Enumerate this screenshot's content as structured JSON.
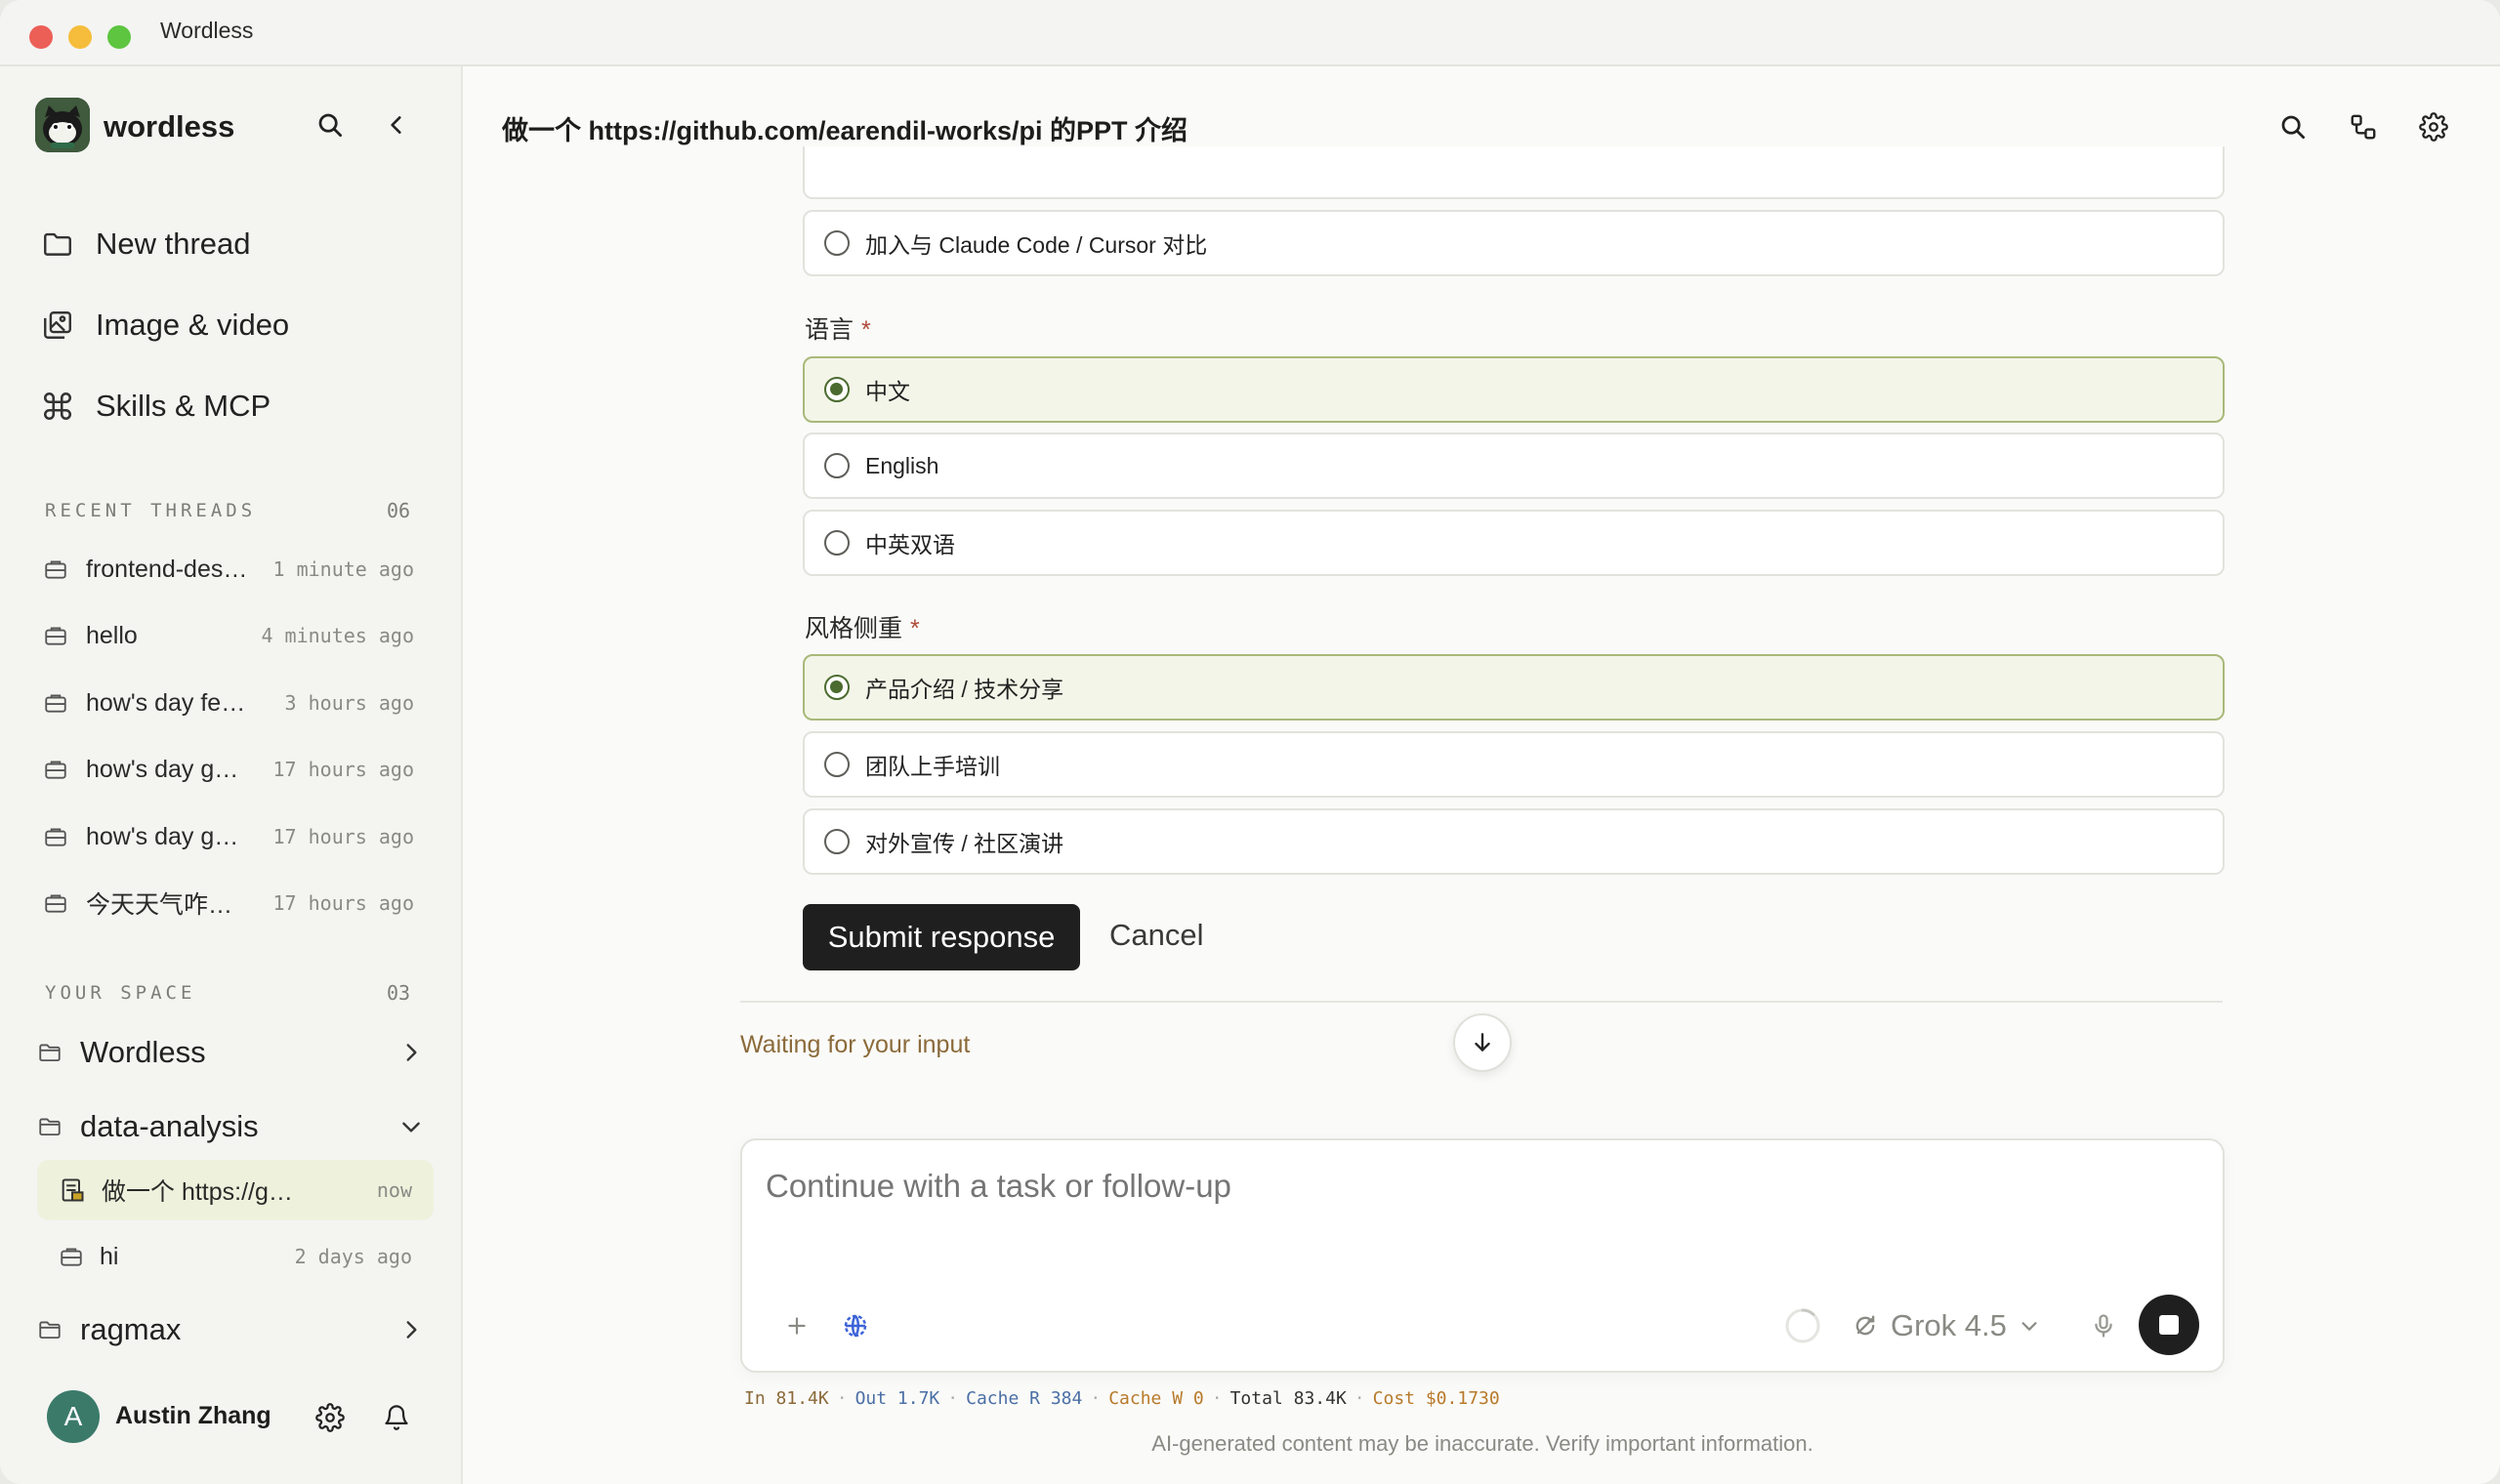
{
  "window": {
    "title": "Wordless"
  },
  "colors": {
    "accent": "#4b6b2f",
    "selected_bg": "#f3f5e8",
    "submit_bg": "#1f1f1f",
    "avatar_bg": "#3b7a69"
  },
  "sidebar": {
    "brand": "wordless",
    "nav": [
      {
        "label": "New thread",
        "icon": "folder-icon"
      },
      {
        "label": "Image & video",
        "icon": "image-gallery-icon"
      },
      {
        "label": "Skills & MCP",
        "icon": "command-icon"
      }
    ],
    "recent": {
      "label": "RECENT THREADS",
      "count": "06",
      "items": [
        {
          "title": "frontend-design",
          "time": "1 minute ago"
        },
        {
          "title": "hello",
          "time": "4 minutes ago"
        },
        {
          "title": "how's day feeling",
          "time": "3 hours ago"
        },
        {
          "title": "how's day going",
          "time": "17 hours ago"
        },
        {
          "title": "how's day going",
          "time": "17 hours ago"
        },
        {
          "title": "今天天气咋样啊",
          "time": "17 hours ago"
        }
      ]
    },
    "space": {
      "label": "YOUR SPACE",
      "count": "03",
      "folders": [
        {
          "name": "Wordless"
        },
        {
          "name": "data-analysis",
          "threads": [
            {
              "title": "做一个 https://github.com/earendil-works/pi 的PPT 介绍",
              "time": "now"
            },
            {
              "title": "hi",
              "time": "2 days ago"
            }
          ]
        },
        {
          "name": "ragmax"
        }
      ]
    },
    "user": {
      "initial": "A",
      "name": "Austin Zhang"
    }
  },
  "main": {
    "title": "做一个 https://github.com/earendil-works/pi 的PPT 介绍",
    "top_option": "加入与 Claude Code / Cursor 对比",
    "questions": [
      {
        "label": "语言",
        "required": "*",
        "options": [
          "中文",
          "English",
          "中英双语"
        ],
        "selected": 0
      },
      {
        "label": "风格侧重",
        "required": "*",
        "options": [
          "产品介绍 / 技术分享",
          "团队上手培训",
          "对外宣传 / 社区演讲"
        ],
        "selected": 0
      }
    ],
    "submit_label": "Submit response",
    "cancel_label": "Cancel",
    "status": "Waiting for your input"
  },
  "composer": {
    "placeholder": "Continue with a task or follow-up",
    "model": "Grok 4.5"
  },
  "usage": {
    "in_key": "In",
    "in_val": "81.4K",
    "out_key": "Out",
    "out_val": "1.7K",
    "cache_r_key": "Cache R",
    "cache_r_val": "384",
    "cache_w_key": "Cache W",
    "cache_w_val": "0",
    "total_key": "Total",
    "total_val": "83.4K",
    "cost_key": "Cost",
    "cost_val": "$0.1730"
  },
  "disclaimer": "AI-generated content may be inaccurate. Verify important information."
}
